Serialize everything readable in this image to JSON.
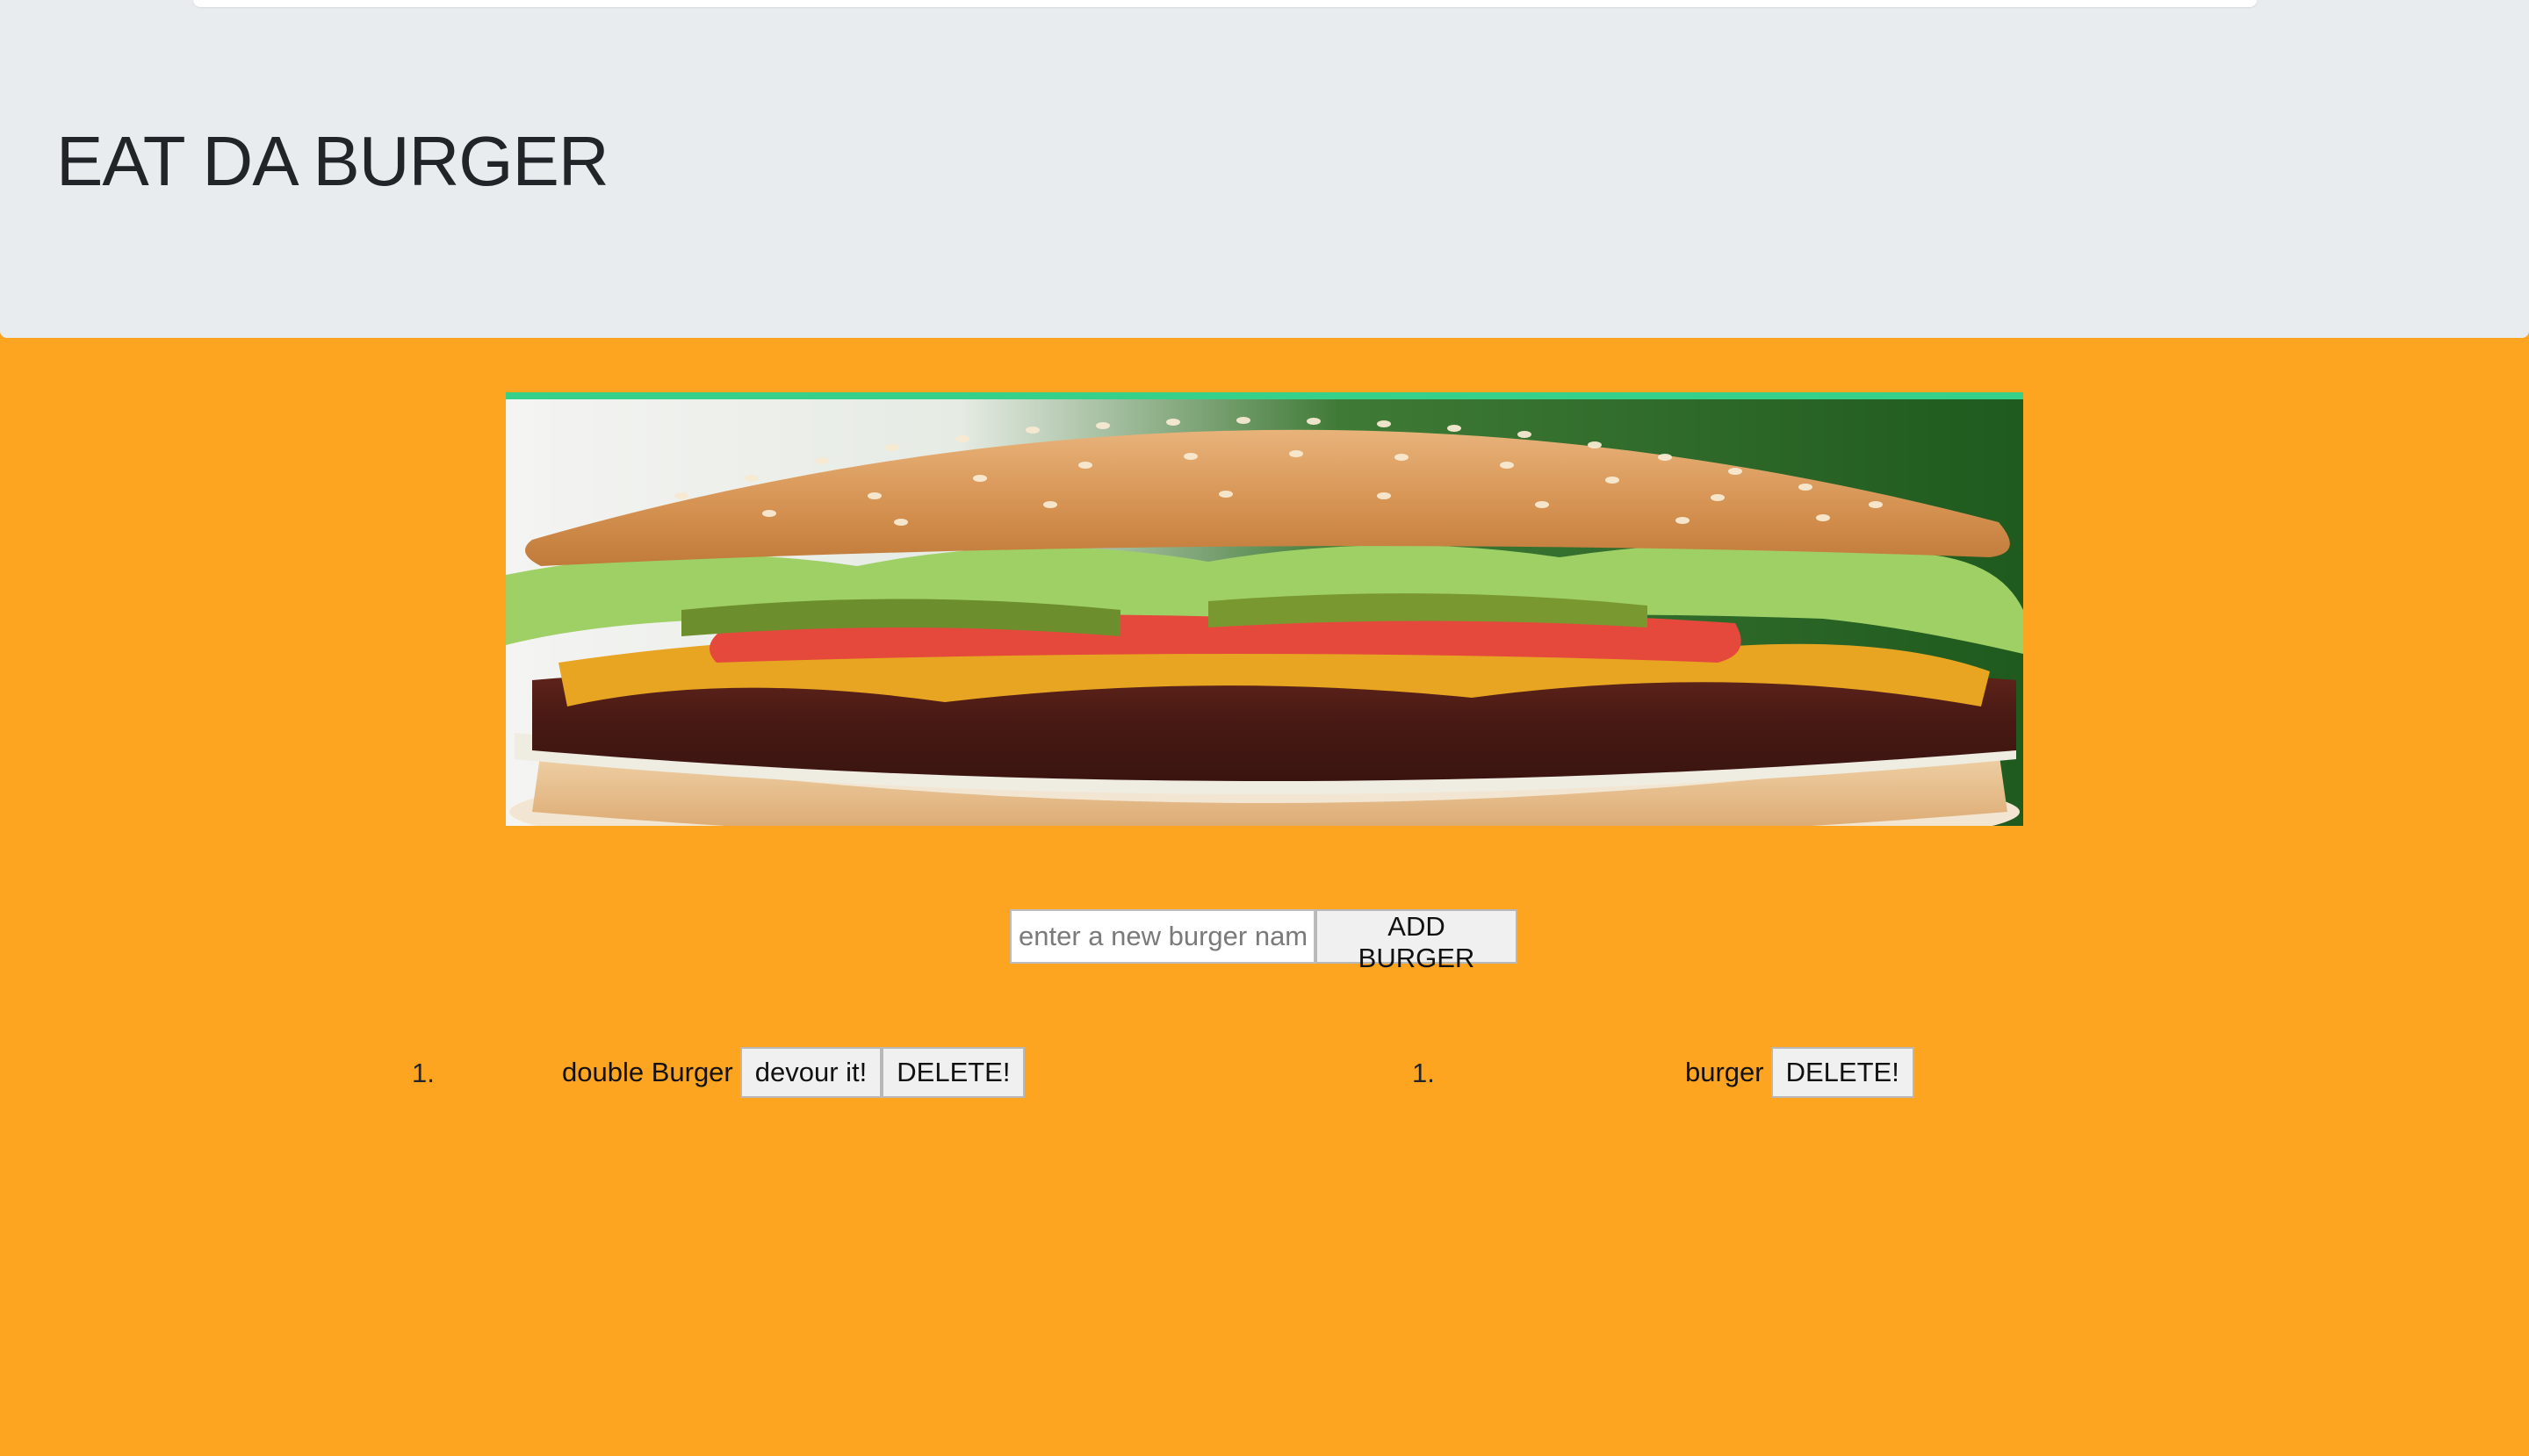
{
  "header": {
    "title": "EAT DA BURGER"
  },
  "hero": {
    "image_alt": "burger photo"
  },
  "form": {
    "placeholder": "enter a new burger name",
    "submit_label": "ADD BURGER"
  },
  "not_devoured": [
    {
      "index": "1.",
      "name": "double Burger",
      "devour_label": "devour it!",
      "delete_label": "DELETE!"
    }
  ],
  "devoured": [
    {
      "index": "1.",
      "name": "burger",
      "delete_label": "DELETE!"
    }
  ],
  "colors": {
    "page_background": "#fda521",
    "header_background": "#e9ecef",
    "image_top_border": "#35d18b"
  }
}
